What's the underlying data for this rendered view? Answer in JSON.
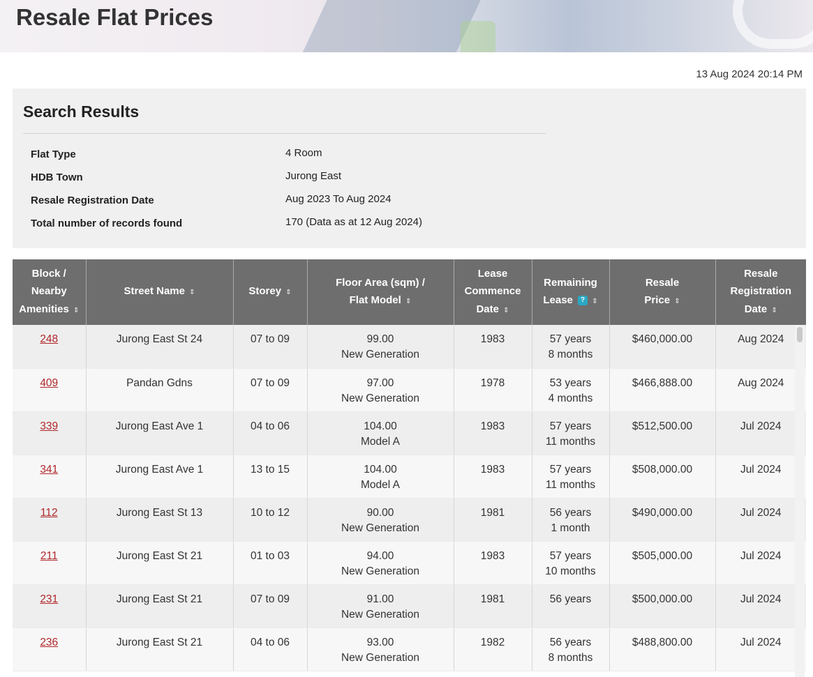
{
  "header": {
    "title": "Resale Flat Prices"
  },
  "timestamp": "13 Aug 2024 20:14 PM",
  "summary": {
    "heading": "Search Results",
    "fields": [
      {
        "label": "Flat Type",
        "value": "4 Room"
      },
      {
        "label": "HDB Town",
        "value": "Jurong East"
      },
      {
        "label": "Resale Registration Date",
        "value": "Aug 2023 To Aug 2024"
      },
      {
        "label": "Total number of records found",
        "value": "170 (Data as at 12 Aug 2024)"
      }
    ]
  },
  "table": {
    "columns": [
      {
        "line1": "Block /",
        "line2": "Nearby",
        "line3": "Amenities",
        "sort_icon": "sort-icon"
      },
      {
        "line1": "Street Name",
        "sort_icon": "sort-icon"
      },
      {
        "line1": "Storey",
        "sort_icon": "sort-icon"
      },
      {
        "line1": "Floor Area (sqm) /",
        "line2": "Flat Model",
        "sort_icon": "sort-icon"
      },
      {
        "line1": "Lease",
        "line2": "Commence",
        "line3": "Date",
        "sort_icon": "sort-icon"
      },
      {
        "line1": "Remaining",
        "line2": "Lease",
        "help": "?",
        "sort_icon": "sort-icon"
      },
      {
        "line1": "Resale",
        "line2": "Price",
        "sort_icon": "sort-icon"
      },
      {
        "line1": "Resale",
        "line2": "Registration",
        "line3": "Date",
        "sort_icon": "sort-icon"
      }
    ],
    "rows": [
      {
        "block": "248",
        "street": "Jurong East St 24",
        "storey": "07 to 09",
        "area": "99.00",
        "model": "New Generation",
        "lease_start": "1983",
        "remaining_years": "57 years",
        "remaining_months": "8 months",
        "price": "$460,000.00",
        "reg_date": "Aug 2024"
      },
      {
        "block": "409",
        "street": "Pandan Gdns",
        "storey": "07 to 09",
        "area": "97.00",
        "model": "New Generation",
        "lease_start": "1978",
        "remaining_years": "53 years",
        "remaining_months": "4 months",
        "price": "$466,888.00",
        "reg_date": "Aug 2024"
      },
      {
        "block": "339",
        "street": "Jurong East Ave 1",
        "storey": "04 to 06",
        "area": "104.00",
        "model": "Model A",
        "lease_start": "1983",
        "remaining_years": "57 years",
        "remaining_months": "11 months",
        "price": "$512,500.00",
        "reg_date": "Jul 2024"
      },
      {
        "block": "341",
        "street": "Jurong East Ave 1",
        "storey": "13 to 15",
        "area": "104.00",
        "model": "Model A",
        "lease_start": "1983",
        "remaining_years": "57 years",
        "remaining_months": "11 months",
        "price": "$508,000.00",
        "reg_date": "Jul 2024"
      },
      {
        "block": "112",
        "street": "Jurong East St 13",
        "storey": "10 to 12",
        "area": "90.00",
        "model": "New Generation",
        "lease_start": "1981",
        "remaining_years": "56 years",
        "remaining_months": "1 month",
        "price": "$490,000.00",
        "reg_date": "Jul 2024"
      },
      {
        "block": "211",
        "street": "Jurong East St 21",
        "storey": "01 to 03",
        "area": "94.00",
        "model": "New Generation",
        "lease_start": "1983",
        "remaining_years": "57 years",
        "remaining_months": "10 months",
        "price": "$505,000.00",
        "reg_date": "Jul 2024"
      },
      {
        "block": "231",
        "street": "Jurong East St 21",
        "storey": "07 to 09",
        "area": "91.00",
        "model": "New Generation",
        "lease_start": "1981",
        "remaining_years": "56 years",
        "remaining_months": "",
        "price": "$500,000.00",
        "reg_date": "Jul 2024"
      },
      {
        "block": "236",
        "street": "Jurong East St 21",
        "storey": "04 to 06",
        "area": "93.00",
        "model": "New Generation",
        "lease_start": "1982",
        "remaining_years": "56 years",
        "remaining_months": "8 months",
        "price": "$488,800.00",
        "reg_date": "Jul 2024"
      }
    ]
  },
  "colors": {
    "header_bg": "#6e6e6e",
    "link": "#b0272b",
    "help_badge": "#2aa8c4",
    "summary_bg": "#f0f0f0"
  }
}
